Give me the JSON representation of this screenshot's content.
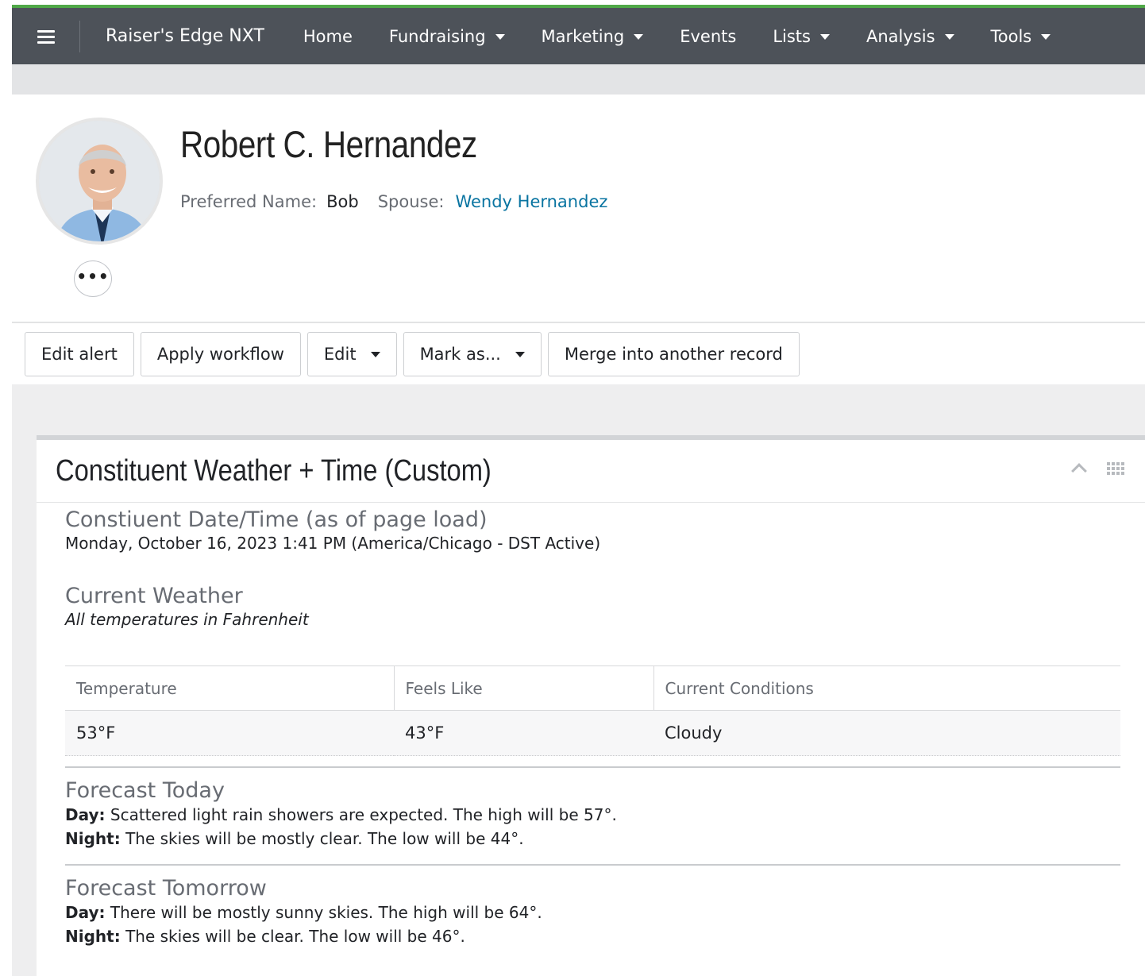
{
  "nav": {
    "brand": "Raiser's Edge NXT",
    "items": [
      {
        "label": "Home",
        "has_caret": false
      },
      {
        "label": "Fundraising",
        "has_caret": true
      },
      {
        "label": "Marketing",
        "has_caret": true
      },
      {
        "label": "Events",
        "has_caret": false
      },
      {
        "label": "Lists",
        "has_caret": true
      },
      {
        "label": "Analysis",
        "has_caret": true
      },
      {
        "label": "Tools",
        "has_caret": true
      }
    ],
    "colors": {
      "bar": "#4d5259",
      "accent": "#50a848"
    }
  },
  "record": {
    "name": "Robert C. Hernandez",
    "preferred_name_label": "Preferred Name:",
    "preferred_name": "Bob",
    "spouse_label": "Spouse:",
    "spouse": "Wendy Hernandez",
    "more_icon": "ellipsis-icon"
  },
  "toolbar": {
    "edit_alert": "Edit alert",
    "apply_workflow": "Apply workflow",
    "edit": "Edit",
    "mark_as": "Mark as...",
    "merge": "Merge into another record"
  },
  "tile": {
    "title": "Constituent Weather + Time (Custom)",
    "datetime": {
      "heading": "Constiuent Date/Time (as of page load)",
      "value": "Monday, October 16, 2023 1:41 PM (America/Chicago - DST Active)"
    },
    "current_weather": {
      "heading": "Current Weather",
      "note": "All temperatures in Fahrenheit",
      "columns": [
        "Temperature",
        "Feels Like",
        "Current Conditions"
      ],
      "row": [
        "53°F",
        "43°F",
        "Cloudy"
      ]
    },
    "forecast_today": {
      "heading": "Forecast Today",
      "day_label": "Day:",
      "day_text": " Scattered light rain showers are expected. The high will be 57°.",
      "night_label": "Night:",
      "night_text": " The skies will be mostly clear. The low will be 44°."
    },
    "forecast_tomorrow": {
      "heading": "Forecast Tomorrow",
      "day_label": "Day:",
      "day_text": " There will be mostly sunny skies. The high will be 64°.",
      "night_label": "Night:",
      "night_text": " The skies will be clear. The low will be 46°."
    }
  }
}
